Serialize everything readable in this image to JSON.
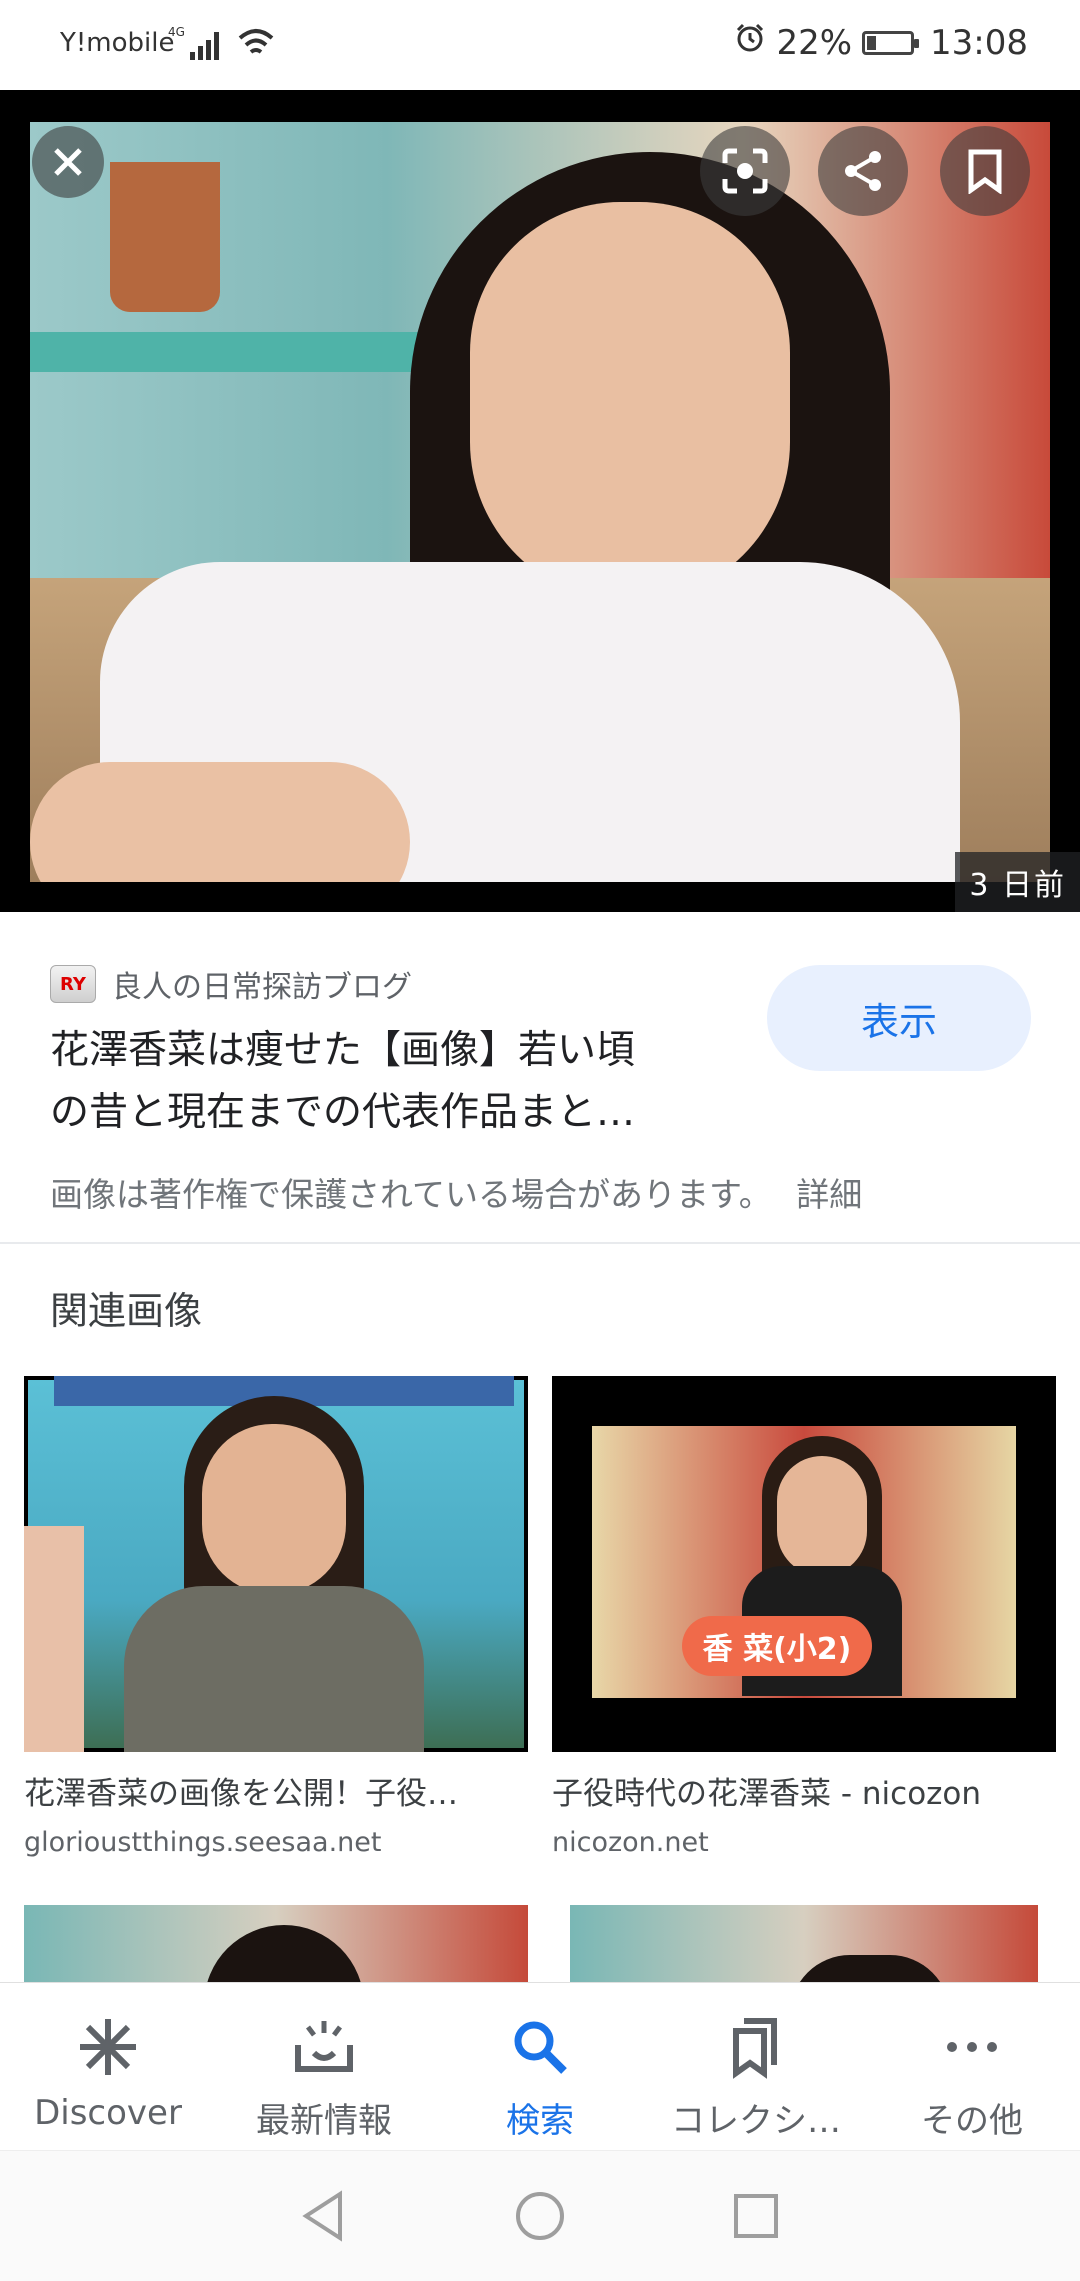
{
  "status_bar": {
    "carrier": "Y!mobile",
    "network": "4G",
    "battery": "22%",
    "battery_level": 0.22,
    "time": "13:08"
  },
  "hero": {
    "time_ago": "3 日前"
  },
  "result": {
    "source_logo_text": "RY",
    "source_name": "良人の日常探訪ブログ",
    "title_line1": "花澤香菜は痩せた【画像】若い頃",
    "title_line2": "の昔と現在までの代表作品まと…",
    "view_button": "表示",
    "copyright_notice": "画像は著作権で保護されている場合があります。",
    "details_link": "詳細"
  },
  "related": {
    "heading": "関連画像",
    "items": [
      {
        "caption": "花澤香菜の画像を公開！子役…",
        "domain": "glorioustthings.seesaa.net"
      },
      {
        "caption": "子役時代の花澤香菜 - nicozon",
        "domain": "nicozon.net",
        "overlay_text": "香 菜(小2)"
      }
    ]
  },
  "bottom_nav": {
    "items": [
      {
        "label": "Discover",
        "icon": "asterisk-icon"
      },
      {
        "label": "最新情報",
        "icon": "updates-icon"
      },
      {
        "label": "検索",
        "icon": "search-icon"
      },
      {
        "label": "コレクシ…",
        "icon": "collections-icon"
      },
      {
        "label": "その他",
        "icon": "more-icon"
      }
    ],
    "active": "検索"
  },
  "colors": {
    "accent": "#1a73e8",
    "view_button_bg": "#e8f0fe"
  }
}
